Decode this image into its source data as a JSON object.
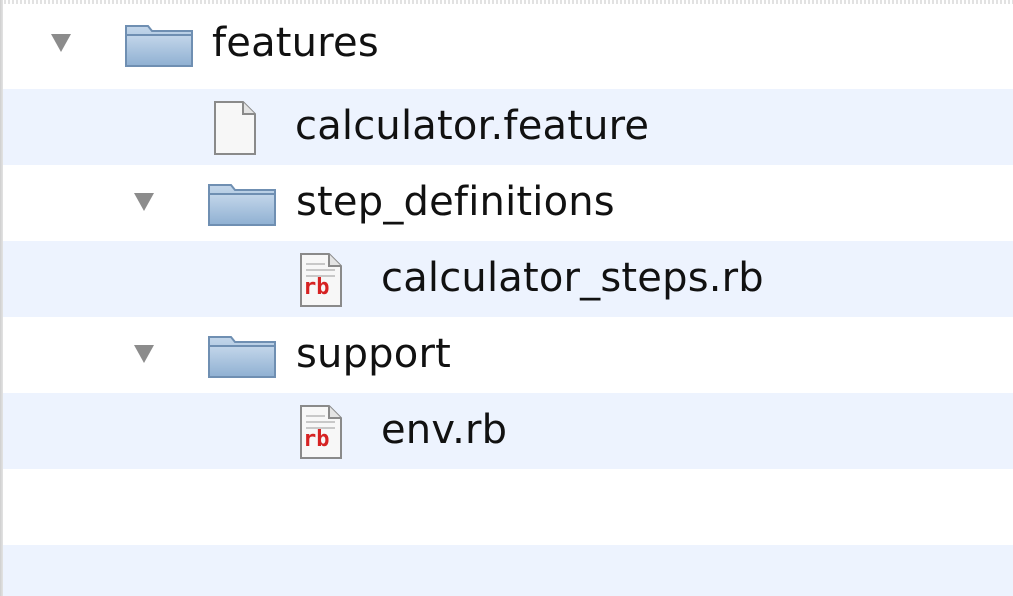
{
  "colors": {
    "row_stripe": "#edf3fe",
    "folder_fill": "#a9c3de",
    "disclosure_triangle": "#8c8c8c",
    "rb_badge": "#d62222"
  },
  "tree": {
    "rows": [
      {
        "kind": "folder",
        "label": "features",
        "expanded": true,
        "icon": "folder-icon"
      },
      {
        "kind": "file",
        "label": "calculator.feature",
        "icon": "document-icon"
      },
      {
        "kind": "folder",
        "label": "step_definitions",
        "expanded": true,
        "icon": "folder-icon"
      },
      {
        "kind": "file",
        "label": "calculator_steps.rb",
        "icon": "ruby-file-icon",
        "badge": "rb"
      },
      {
        "kind": "folder",
        "label": "support",
        "expanded": true,
        "icon": "folder-icon"
      },
      {
        "kind": "file",
        "label": "env.rb",
        "icon": "ruby-file-icon",
        "badge": "rb"
      }
    ]
  }
}
